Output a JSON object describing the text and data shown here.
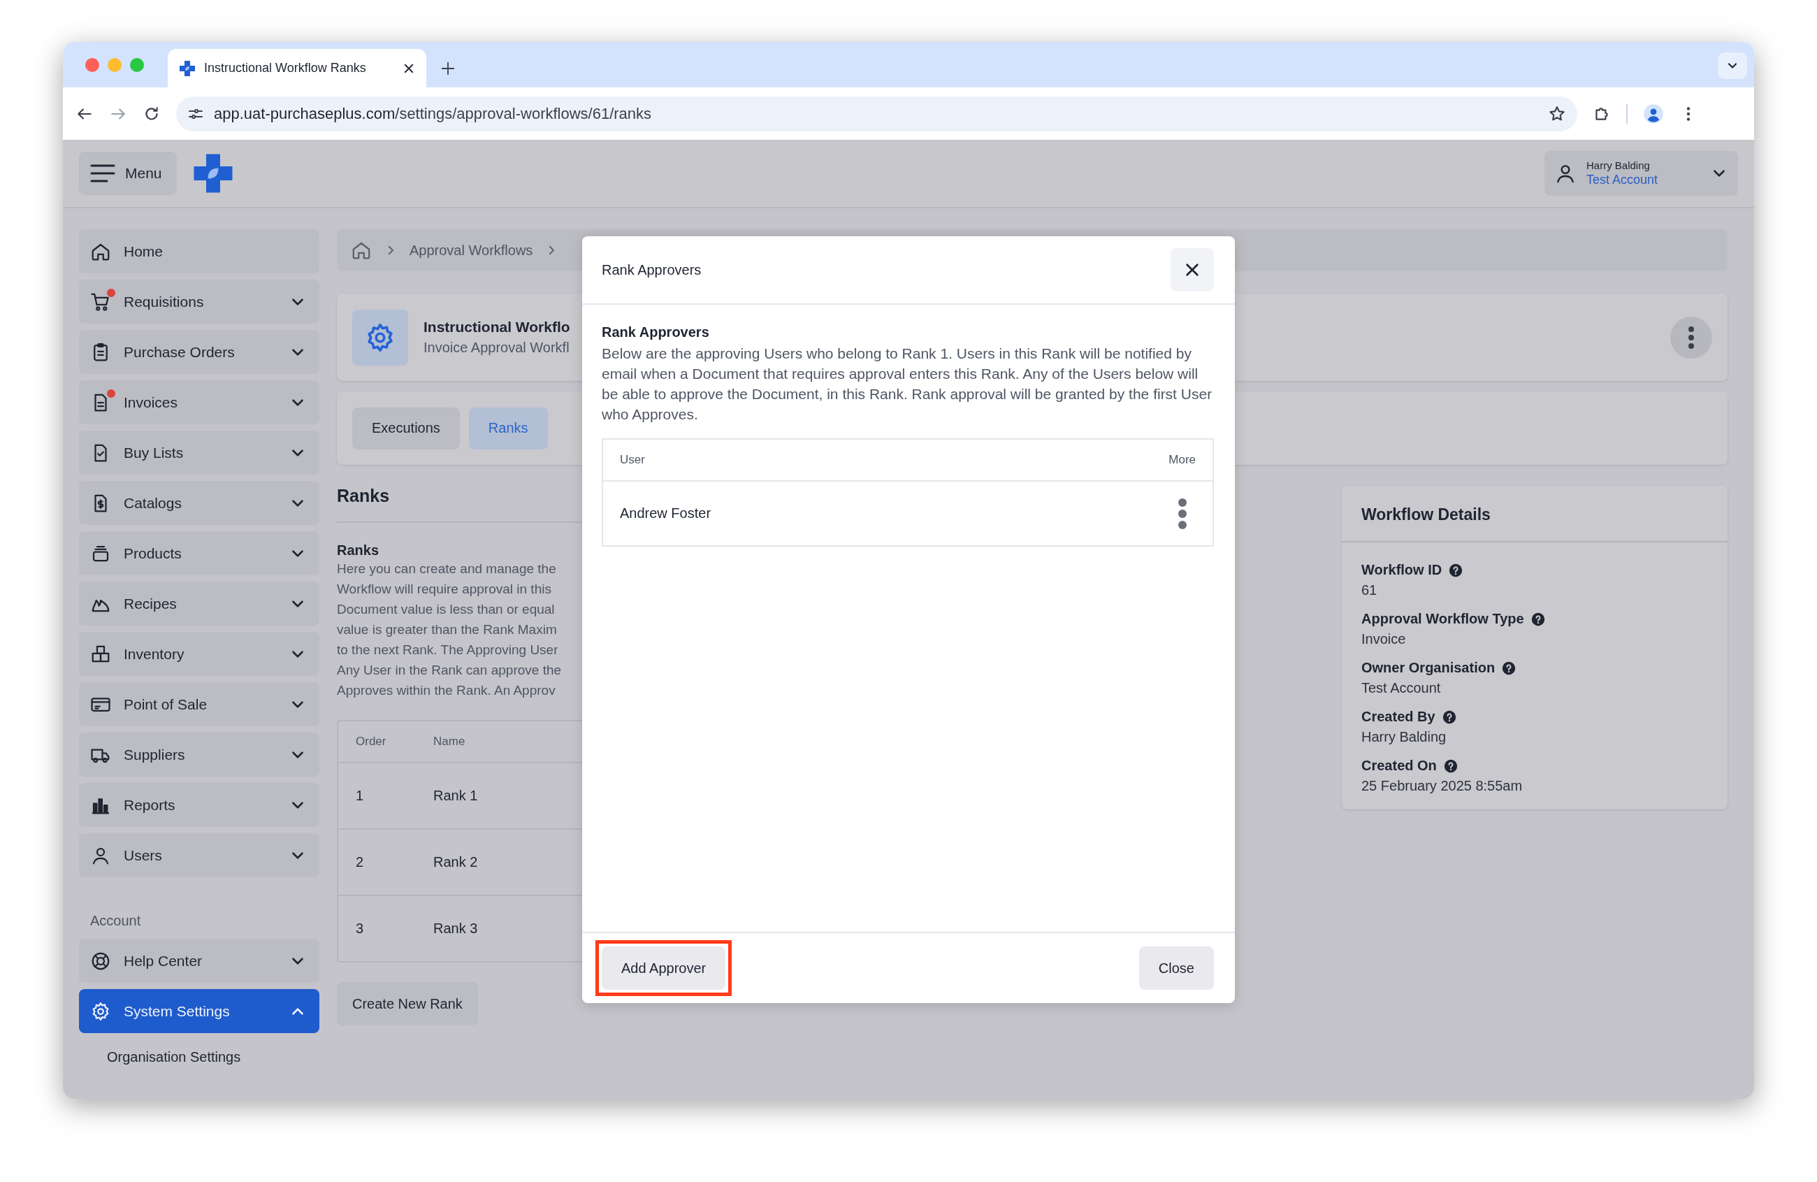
{
  "browser": {
    "tab_title": "Instructional Workflow Ranks",
    "url_host": "app.uat-purchaseplus.com",
    "url_path": "/settings/approval-workflows/61/ranks"
  },
  "header": {
    "menu_label": "Menu",
    "user_name": "Harry Balding",
    "account": "Test Account"
  },
  "sidebar": {
    "items": [
      {
        "label": "Home",
        "kind": "link",
        "notification": false,
        "selected": false
      },
      {
        "label": "Requisitions",
        "kind": "group",
        "notification": true,
        "expanded": false,
        "selected": false
      },
      {
        "label": "Purchase Orders",
        "kind": "group",
        "notification": false,
        "expanded": false,
        "selected": false
      },
      {
        "label": "Invoices",
        "kind": "group",
        "notification": true,
        "expanded": false,
        "selected": false
      },
      {
        "label": "Buy Lists",
        "kind": "group",
        "notification": false,
        "expanded": false,
        "selected": false
      },
      {
        "label": "Catalogs",
        "kind": "group",
        "notification": false,
        "expanded": false,
        "selected": false
      },
      {
        "label": "Products",
        "kind": "group",
        "notification": false,
        "expanded": false,
        "selected": false
      },
      {
        "label": "Recipes",
        "kind": "group",
        "notification": false,
        "expanded": false,
        "selected": false
      },
      {
        "label": "Inventory",
        "kind": "group",
        "notification": false,
        "expanded": false,
        "selected": false
      },
      {
        "label": "Point of Sale",
        "kind": "group",
        "notification": false,
        "expanded": false,
        "selected": false
      },
      {
        "label": "Suppliers",
        "kind": "group",
        "notification": false,
        "expanded": false,
        "selected": false
      },
      {
        "label": "Reports",
        "kind": "group",
        "notification": false,
        "expanded": false,
        "selected": false
      },
      {
        "label": "Users",
        "kind": "group",
        "notification": false,
        "expanded": false,
        "selected": false
      }
    ],
    "section_label": "Account",
    "account_items": [
      {
        "label": "Help Center",
        "kind": "group",
        "notification": false,
        "expanded": false,
        "selected": false
      },
      {
        "label": "System Settings",
        "kind": "group",
        "notification": false,
        "expanded": true,
        "selected": true,
        "children": [
          {
            "label": "Organisation Settings"
          }
        ]
      }
    ]
  },
  "breadcrumb": [
    "Approval Workflows"
  ],
  "workflow": {
    "title": "Instructional Workflo",
    "subtitle": "Invoice Approval Workfl"
  },
  "tabs": [
    {
      "label": "Executions",
      "selected": false
    },
    {
      "label": "Ranks",
      "selected": true
    }
  ],
  "ranks": {
    "heading": "Ranks",
    "intro_title": "Ranks",
    "intro_lines": [
      "Here you can create and manage the",
      "Workflow will require approval in this",
      "Document value is less than or equal",
      "value is greater than the Rank Maxim",
      "to the next Rank. The Approving User",
      "Any User in the Rank can approve the",
      "Approves within the Rank. An Approv"
    ],
    "columns": [
      "Order",
      "Name"
    ],
    "rows": [
      {
        "order": "1",
        "name": "Rank 1"
      },
      {
        "order": "2",
        "name": "Rank 2"
      },
      {
        "order": "3",
        "name": "Rank 3"
      }
    ],
    "create_button": "Create New Rank"
  },
  "details": {
    "title": "Workflow Details",
    "fields": [
      {
        "label": "Workflow ID",
        "value": "61"
      },
      {
        "label": "Approval Workflow Type",
        "value": "Invoice"
      },
      {
        "label": "Owner Organisation",
        "value": "Test Account"
      },
      {
        "label": "Created By",
        "value": "Harry Balding"
      },
      {
        "label": "Created On",
        "value": "25 February 2025 8:55am"
      }
    ]
  },
  "modal": {
    "title": "Rank Approvers",
    "section_title": "Rank Approvers",
    "description": "Below are the approving Users who belong to Rank 1. Users in this Rank will be notified by email when a Document that requires approval enters this Rank. Any of the Users below will be able to approve the Document, in this Rank. Rank approval will be granted by the first User who Approves.",
    "columns": [
      "User",
      "More"
    ],
    "rows": [
      {
        "user": "Andrew Foster"
      }
    ],
    "buttons": [
      {
        "label": "Add Approver",
        "highlighted": true
      },
      {
        "label": "Close",
        "highlighted": false
      }
    ]
  }
}
